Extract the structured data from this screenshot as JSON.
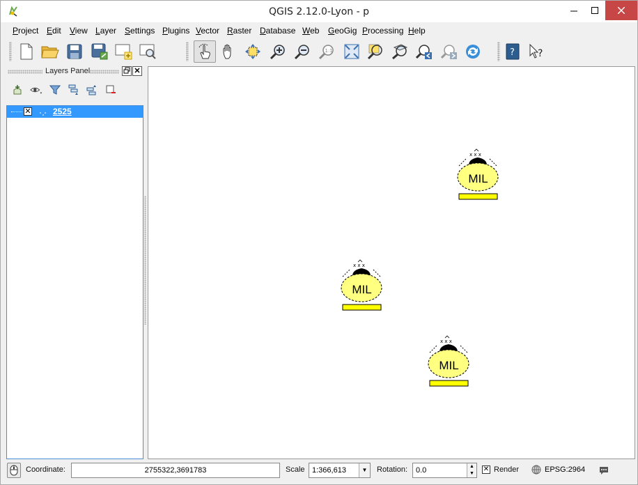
{
  "window": {
    "title": "QGIS 2.12.0-Lyon - p"
  },
  "menu": [
    "Project",
    "Edit",
    "View",
    "Layer",
    "Settings",
    "Plugins",
    "Vector",
    "Raster",
    "Database",
    "Web",
    "GeoGig",
    "Processing",
    "Help"
  ],
  "toolbar": {
    "buttons": [
      "new-project-icon",
      "open-project-icon",
      "save-project-icon",
      "save-as-icon",
      "new-print-composer-icon",
      "composer-manager-icon",
      "touch-zoom-pan-icon",
      "pan-icon",
      "pan-to-selection-icon",
      "zoom-in-icon",
      "zoom-out-icon",
      "zoom-actual-size-icon",
      "zoom-full-icon",
      "zoom-to-selection-icon",
      "zoom-to-layer-icon",
      "zoom-last-icon",
      "zoom-next-icon",
      "refresh-icon",
      "help-contents-icon",
      "whats-this-icon"
    ]
  },
  "layers_panel": {
    "title": "Layers Panel",
    "layers": [
      {
        "name": "2525",
        "visible": true
      }
    ]
  },
  "map": {
    "symbols": [
      {
        "label": "MIL"
      },
      {
        "label": "MIL"
      },
      {
        "label": "MIL"
      }
    ]
  },
  "statusbar": {
    "coordinate_label": "Coordinate:",
    "coordinate_value": "2755322,3691783",
    "scale_label": "Scale",
    "scale_value": "1:366,613",
    "rotation_label": "Rotation:",
    "rotation_value": "0.0",
    "render_label": "Render",
    "render_checked": true,
    "crs_label": "EPSG:2964"
  },
  "colors": {
    "symbol_fill": "#ffff80",
    "symbol_base": "#ffff00",
    "selection": "#3399ff",
    "close_button": "#c74747"
  }
}
